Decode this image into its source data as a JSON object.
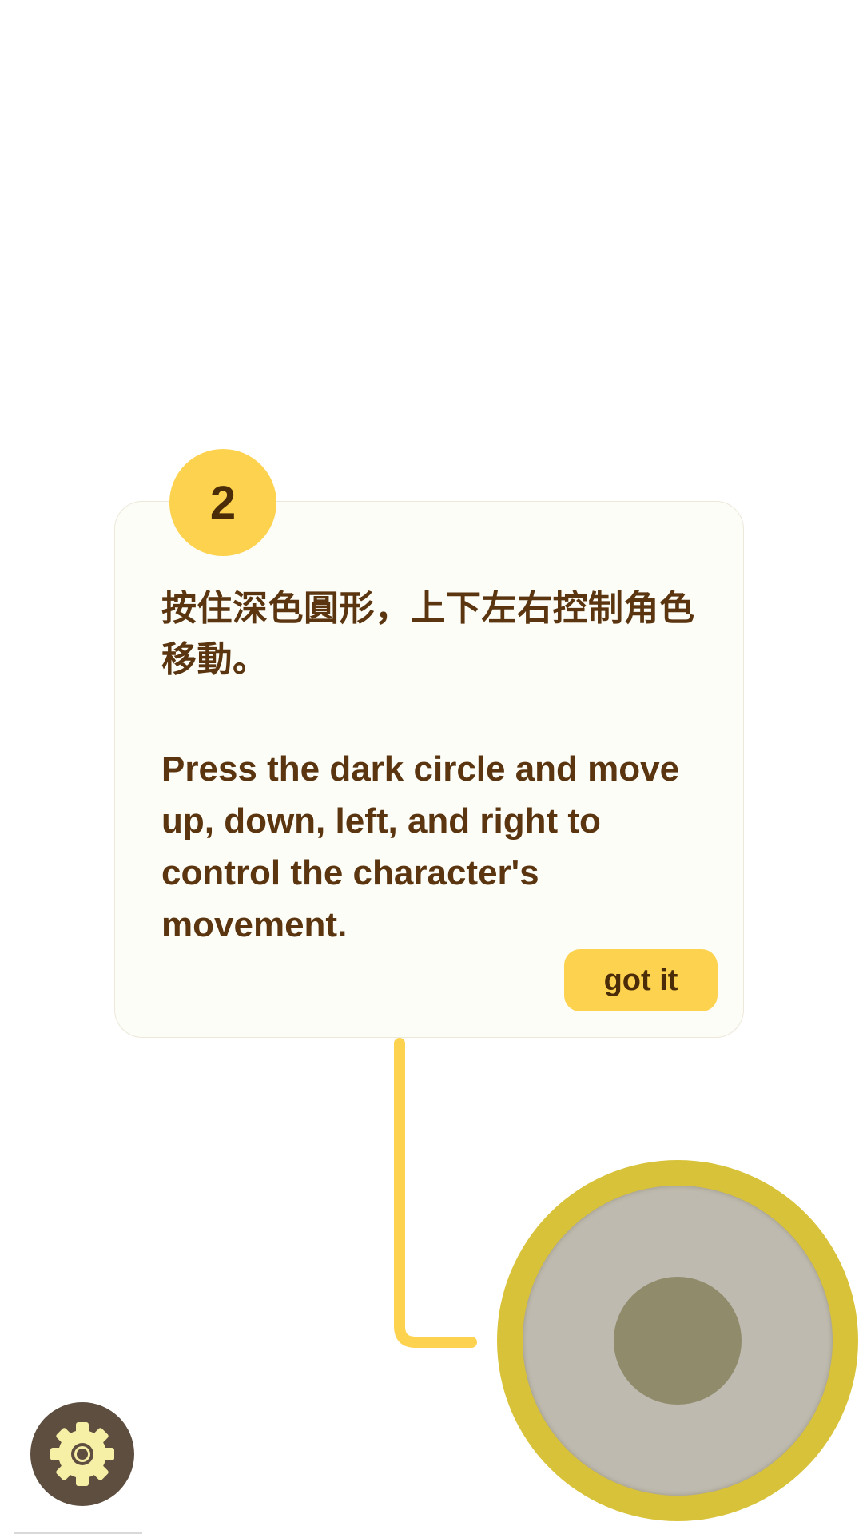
{
  "tutorial": {
    "step_number": "2",
    "text_zh": "按住深色圓形，上下左右控制角色移動。",
    "text_en": "Press the dark circle and move up, down, left, and right to control the character's movement.",
    "button_label": "got it"
  },
  "controls": {
    "joystick_icon": "joystick-icon",
    "settings_icon": "gear-icon"
  },
  "colors": {
    "accent": "#fdd24f",
    "text": "#5a3510",
    "card": "#fdfdf7",
    "joystick_ring": "#d8c23a",
    "joystick_pad": "#bebaaf",
    "joystick_knob": "#8f8b6b",
    "settings_bg": "#5e4e40",
    "gear": "#f6efa6"
  }
}
